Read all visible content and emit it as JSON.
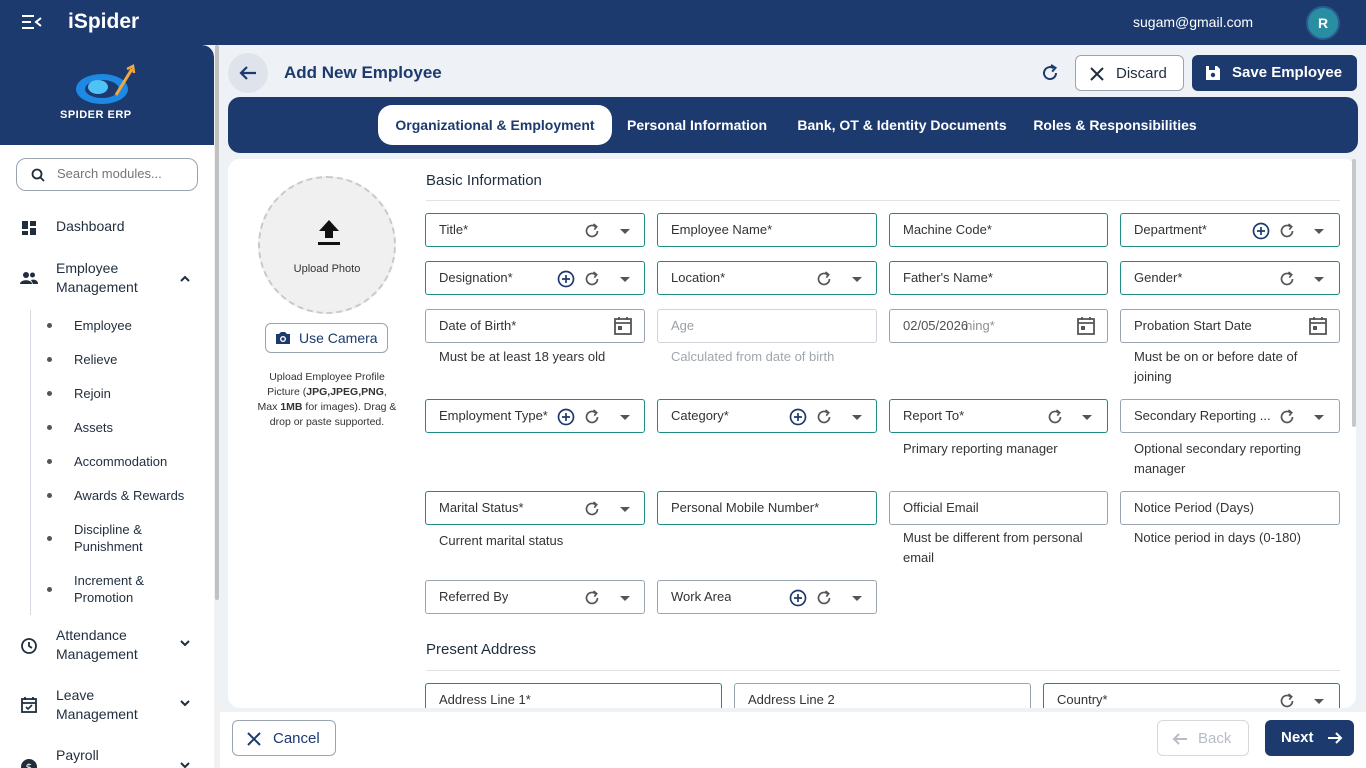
{
  "app": {
    "name": "iSpider",
    "user_email": "sugam@gmail.com",
    "avatar_initial": "R",
    "logo_text": "SPIDER ERP"
  },
  "sidebar": {
    "search_placeholder": "Search modules...",
    "items": [
      {
        "label": "Dashboard"
      },
      {
        "label": "Employee Management"
      },
      {
        "label": "Attendance Management"
      },
      {
        "label": "Leave Management"
      },
      {
        "label": "Payroll"
      }
    ],
    "sub_items": [
      "Employee",
      "Relieve",
      "Rejoin",
      "Assets",
      "Accommodation",
      "Awards & Rewards",
      "Discipline & Punishment",
      "Increment & Promotion"
    ]
  },
  "header": {
    "title": "Add New Employee",
    "discard_label": "Discard",
    "save_label": "Save Employee"
  },
  "tabs": [
    {
      "label": "Organizational & Employment",
      "active": true
    },
    {
      "label": "Personal Information",
      "active": false
    },
    {
      "label": "Bank, OT & Identity Documents",
      "active": false
    },
    {
      "label": "Roles & Responsibilities",
      "active": false
    }
  ],
  "photo": {
    "upload_label": "Upload Photo",
    "camera_label": "Use Camera",
    "help_1": "Upload Employee Profile Picture (",
    "help_bold_1": "JPG,JPEG,PNG",
    "help_2": ", Max ",
    "help_bold_2": "1MB",
    "help_3": " for images). Drag & drop or paste supported."
  },
  "basic": {
    "title": "Basic Information",
    "fields": {
      "title": "Title*",
      "employee_name": "Employee Name*",
      "machine_code": "Machine Code*",
      "department": "Department*",
      "designation": "Designation*",
      "location": "Location*",
      "fathers_name": "Father's Name*",
      "gender": "Gender*",
      "dob": "Date of Birth*",
      "age": "Age",
      "doj_value": "02/05/2026",
      "doj_label": "Date of Joining*",
      "probation": "Probation Start Date",
      "employment_type": "Employment Type*",
      "category": "Category*",
      "report_to": "Report To*",
      "secondary_reporting": "Secondary Reporting ...",
      "marital_status": "Marital Status*",
      "mobile": "Personal Mobile Number*",
      "official_email": "Official Email",
      "notice_period": "Notice Period (Days)",
      "referred_by": "Referred By",
      "work_area": "Work Area"
    },
    "hints": {
      "dob": "Must be at least 18 years old",
      "age": "Calculated from date of birth",
      "probation": "Must be on or before date of joining",
      "report_to": "Primary reporting manager",
      "secondary": "Optional secondary reporting manager",
      "marital": "Current marital status",
      "official_email": "Must be different from personal email",
      "notice": "Notice period in days (0-180)"
    }
  },
  "present_address": {
    "title": "Present Address",
    "fields": {
      "line1": "Address Line 1*",
      "line2": "Address Line 2",
      "country": "Country*"
    }
  },
  "footer": {
    "cancel_label": "Cancel",
    "back_label": "Back",
    "next_label": "Next"
  },
  "colors": {
    "primary": "#1d3a6e",
    "required_border": "#1f8c84",
    "avatar": "#2a8ea3"
  }
}
